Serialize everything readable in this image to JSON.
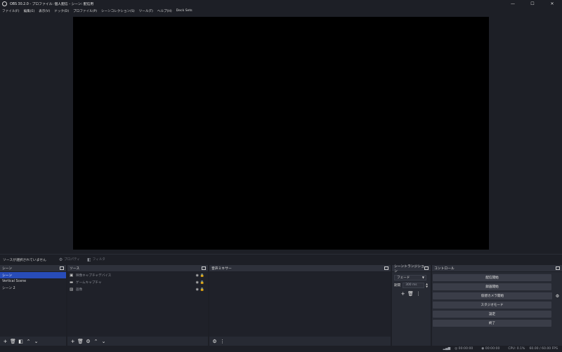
{
  "window": {
    "title": "OBS 30.2.0 - プロファイル: 個人配信 - シーン: 配信用",
    "minimize": "—",
    "maximize": "☐",
    "close": "✕"
  },
  "menu": [
    "ファイル(F)",
    "編集(E)",
    "表示(V)",
    "ドック(D)",
    "プロファイル(P)",
    "シーンコレクション(S)",
    "ツール(T)",
    "ヘルプ(H)",
    "Deck Sets"
  ],
  "context_bar": {
    "no_source": "ソースが選択されていません",
    "properties": "プロパティ",
    "filters": "フィルタ"
  },
  "scenes": {
    "title": "シーン",
    "items": [
      "シーン",
      "Vertical Scene",
      "シーン 2"
    ],
    "selected_index": 0
  },
  "sources": {
    "title": "ソース",
    "items": [
      {
        "icon": "camera-icon",
        "label": "映像キャプチャデバイス"
      },
      {
        "icon": "gamepad-icon",
        "label": "ゲームキャプチャ"
      },
      {
        "icon": "image-icon",
        "label": "画像"
      }
    ]
  },
  "audio_mixer": {
    "title": "音声ミキサー"
  },
  "transitions": {
    "title": "シーントランジション",
    "selected": "フェード",
    "duration_label": "期間",
    "duration_value": "300 ms"
  },
  "controls": {
    "title": "コントロール",
    "buttons": [
      "配信開始",
      "録画開始",
      "仮想カメラ開始",
      "スタジオモード",
      "設定",
      "終了"
    ]
  },
  "status": {
    "rec_time": "00:00:00",
    "stream_time": "00:00:00",
    "cpu": "CPU: 0.1%",
    "fps": "60.00 / 60.00 FPS"
  }
}
